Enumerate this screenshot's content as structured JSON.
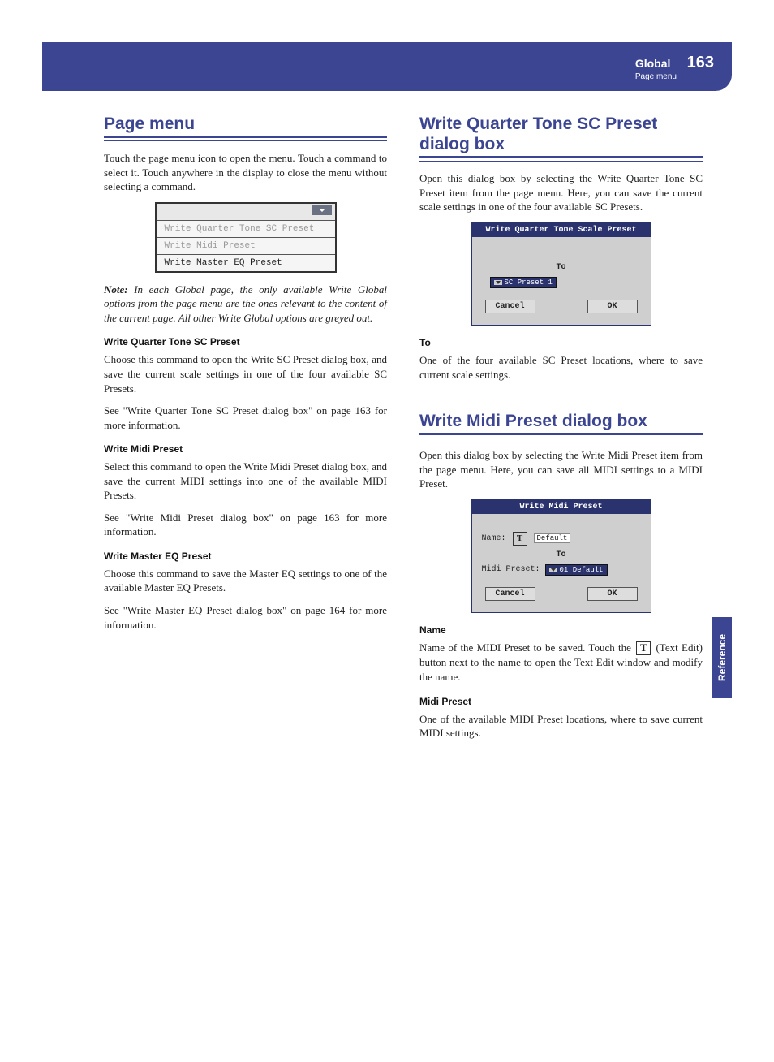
{
  "header": {
    "section": "Global",
    "page_number": "163",
    "subtitle": "Page menu"
  },
  "side_tab": "Reference",
  "left": {
    "h_page_menu": "Page menu",
    "p_intro": "Touch the page menu icon to open the menu. Touch a command to select it. Touch anywhere in the display to close the menu without selecting a command.",
    "menu": {
      "item1": "Write Quarter Tone SC Preset",
      "item2": "Write Midi Preset",
      "item3": "Write Master EQ Preset"
    },
    "note_label": "Note:",
    "note_body": " In each Global page, the only available Write Global options from the page menu are the ones relevant to the content of the current page. All other Write Global options are greyed out.",
    "sh1": "Write Quarter Tone SC Preset",
    "p1a": "Choose this command to open the Write SC Preset dialog box, and save the current scale settings in one of the four available SC Presets.",
    "p1b": "See \"Write Quarter Tone SC Preset dialog box\" on page 163 for more information.",
    "sh2": "Write Midi Preset",
    "p2a": "Select this command to open the Write Midi Preset dialog box, and save the current MIDI settings into one of the available MIDI Presets.",
    "p2b": "See \"Write Midi Preset dialog box\" on page 163 for more information.",
    "sh3": "Write Master EQ Preset",
    "p3a": "Choose this command to save the Master EQ settings to one of the available Master EQ Presets.",
    "p3b": "See \"Write Master EQ Preset dialog box\" on page 164 for more information."
  },
  "right": {
    "sec1": {
      "h": "Write Quarter Tone SC Preset dialog box",
      "p_intro": "Open this dialog box by selecting the Write Quarter Tone SC Preset item from the page menu. Here, you can save the current scale settings in one of the four available SC Presets.",
      "dlg": {
        "title": "Write Quarter Tone Scale Preset",
        "to_label": "To",
        "dd_value": "SC Preset 1",
        "cancel": "Cancel",
        "ok": "OK"
      },
      "sh_to": "To",
      "p_to": "One of the four available SC Preset locations, where to save current scale settings."
    },
    "sec2": {
      "h": "Write Midi Preset dialog box",
      "p_intro": "Open this dialog box by selecting the Write Midi Preset item from the page menu. Here, you can save all MIDI settings to a MIDI Preset.",
      "dlg": {
        "title": "Write Midi Preset",
        "name_label": "Name:",
        "t_icon_text": "T",
        "name_value": "Default",
        "to_label": "To",
        "mp_label": "Midi Preset:",
        "dd_value": "01 Default",
        "cancel": "Cancel",
        "ok": "OK"
      },
      "sh_name": "Name",
      "p_name_a": "Name of the MIDI Preset to be saved. Touch the ",
      "p_name_b": " (Text Edit) button next to the name to open the Text Edit window and modify the name.",
      "sh_mp": "Midi Preset",
      "p_mp": "One of the available MIDI Preset locations, where to save current MIDI settings."
    }
  }
}
